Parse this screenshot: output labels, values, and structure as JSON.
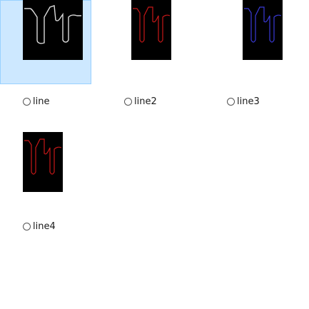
{
  "items": [
    {
      "label": "line",
      "selected": true,
      "curve_color": "#d9d9d9"
    },
    {
      "label": "line2",
      "selected": false,
      "curve_color": "#c71818"
    },
    {
      "label": "line3",
      "selected": false,
      "curve_color": "#3a3ad6"
    },
    {
      "label": "line4",
      "selected": false,
      "curve_color": "#c71818"
    }
  ],
  "colors": {
    "selection_fill": "#cde8ff",
    "selection_border": "#99d1ff",
    "thumbnail_background": "#000000"
  }
}
